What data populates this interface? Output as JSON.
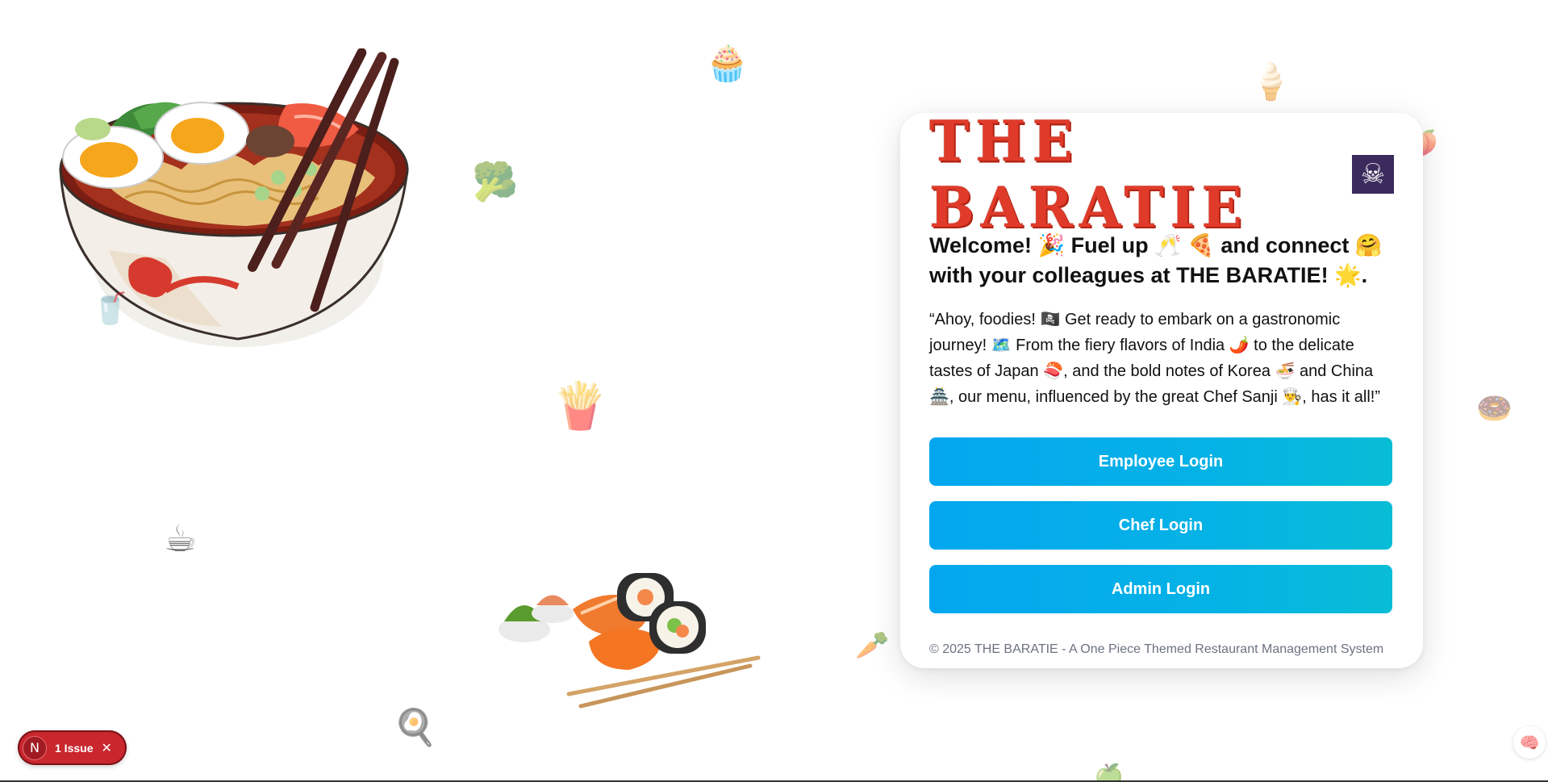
{
  "brand": {
    "title": "THE BARATIE",
    "flag_icon": "☠"
  },
  "welcome": {
    "heading_line1": "Welcome! 🎉 Fuel up 🥂 🍕 and connect 🤗",
    "heading_line2": "with your colleagues at THE BARATIE! 🌟."
  },
  "quote": {
    "line1": "“Ahoy, foodies! 🏴‍☠️ Get ready to embark on a gastronomic",
    "line2": "journey! 🗺️ From the fiery flavors of India 🌶️ to the delicate",
    "line3": "tastes of Japan 🍣, and the bold notes of Korea 🍜 and China",
    "line4": "🏯, our menu, influenced by the great Chef Sanji 👨‍🍳, has it all!”"
  },
  "buttons": {
    "employee": "Employee Login",
    "chef": "Chef Login",
    "admin": "Admin Login"
  },
  "footer": {
    "text": "© 2025 THE BARATIE - A One Piece Themed Restaurant Management System"
  },
  "issue_badge": {
    "logo": "N",
    "label": "1 Issue",
    "close": "✕"
  },
  "assistant": {
    "icon": "brain-icon"
  },
  "decorations": [
    {
      "name": "cupcake-icon",
      "glyph": "🧁"
    },
    {
      "name": "ice-cream-icon",
      "glyph": "🍦"
    },
    {
      "name": "broccoli-icon",
      "glyph": "🥦"
    },
    {
      "name": "fries-icon",
      "glyph": "🍟"
    },
    {
      "name": "cup-icon",
      "glyph": "🥤"
    },
    {
      "name": "coffee-icon",
      "glyph": "☕"
    },
    {
      "name": "donut-icon",
      "glyph": "🍩"
    },
    {
      "name": "carrot-icon",
      "glyph": "🥕"
    },
    {
      "name": "frying-pan-icon",
      "glyph": "🍳"
    },
    {
      "name": "food-icon",
      "glyph": "🍑"
    },
    {
      "name": "apple-icon",
      "glyph": "🍏"
    }
  ],
  "colors": {
    "brand_red": "#e03b2a",
    "button_blue": "#04a7ef",
    "issue_red": "#c9262e",
    "footer_gray": "#6b7280"
  }
}
